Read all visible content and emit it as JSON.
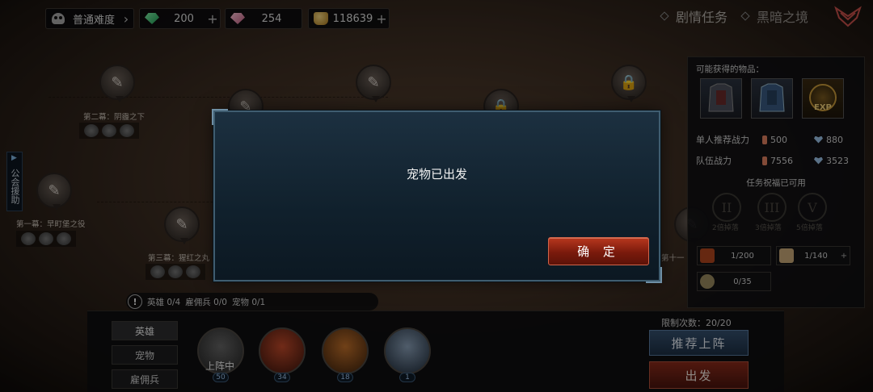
{
  "topbar": {
    "difficulty": "普通难度",
    "green_gems": "200",
    "pink_gems": "254",
    "gold": "118639",
    "tab_story": "剧情任务",
    "tab_dark": "黑暗之境"
  },
  "map": {
    "node_act2_label": "第二幕：阴霾之下",
    "node_act1_label": "第一幕：早町堡之役",
    "node_act3_label": "第三幕：猩红之丸",
    "node_act11_label": "第十一"
  },
  "side_tab": {
    "label": "公会援助"
  },
  "right_panel": {
    "possible_items_title": "可能获得的物品：",
    "exp_label": "EXP",
    "recommended_power_label": "单人推荐战力",
    "recommended_power_value": "500",
    "recommended_hp_value": "880",
    "team_power_label": "队伍战力",
    "team_power_value": "7556",
    "team_hp_value": "3523",
    "blessing_title": "任务祝福已可用",
    "blessings": [
      {
        "numeral": "II",
        "label": "2倍掉落"
      },
      {
        "numeral": "III",
        "label": "3倍掉落"
      },
      {
        "numeral": "V",
        "label": "5倍掉落"
      }
    ],
    "resources": [
      {
        "value": "1/200",
        "color": "#b0461e"
      },
      {
        "value": "1/140",
        "color": "#c8a878"
      },
      {
        "value": "0/35",
        "color": "#9a8a60"
      }
    ]
  },
  "hint_bar": {
    "heroes": "英雄 0/4",
    "mercs": "雇佣兵 0/0",
    "pets": "宠物 0/1"
  },
  "bottom": {
    "categories": [
      "英雄",
      "宠物",
      "雇佣兵"
    ],
    "deploying_label": "上阵中",
    "hero_levels": [
      "50",
      "34",
      "18",
      "1"
    ],
    "limit_label": "限制次数：20/20",
    "recommend_button": "推荐上阵",
    "depart_button": "出发"
  },
  "dialog": {
    "message": "宠物已出发",
    "confirm": "确 定"
  }
}
